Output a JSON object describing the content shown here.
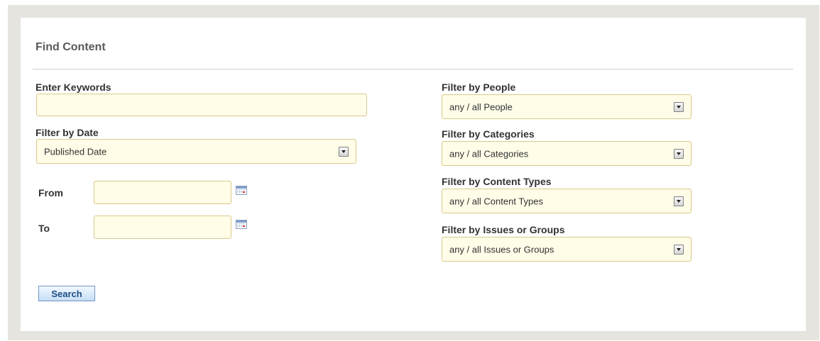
{
  "page": {
    "title": "Find Content"
  },
  "keywords": {
    "label": "Enter Keywords",
    "value": "",
    "placeholder": ""
  },
  "date_filter": {
    "label": "Filter by Date",
    "selected": "Published Date",
    "from_label": "From",
    "from_value": "",
    "to_label": "To",
    "to_value": ""
  },
  "people_filter": {
    "label": "Filter by People",
    "selected": "any / all People"
  },
  "categories_filter": {
    "label": "Filter by Categories",
    "selected": "any / all Categories"
  },
  "content_types_filter": {
    "label": "Filter by Content Types",
    "selected": "any / all Content Types"
  },
  "issues_filter": {
    "label": "Filter by Issues or Groups",
    "selected": "any / all Issues or Groups"
  },
  "actions": {
    "search_label": "Search"
  },
  "colors": {
    "field_background": "#fffce8",
    "field_border": "#d8c98a",
    "frame_background": "#e6e4df",
    "button_text": "#1f4e82"
  },
  "icons": {
    "calendar": "calendar-icon",
    "dropdown": "chevron-down-icon"
  }
}
